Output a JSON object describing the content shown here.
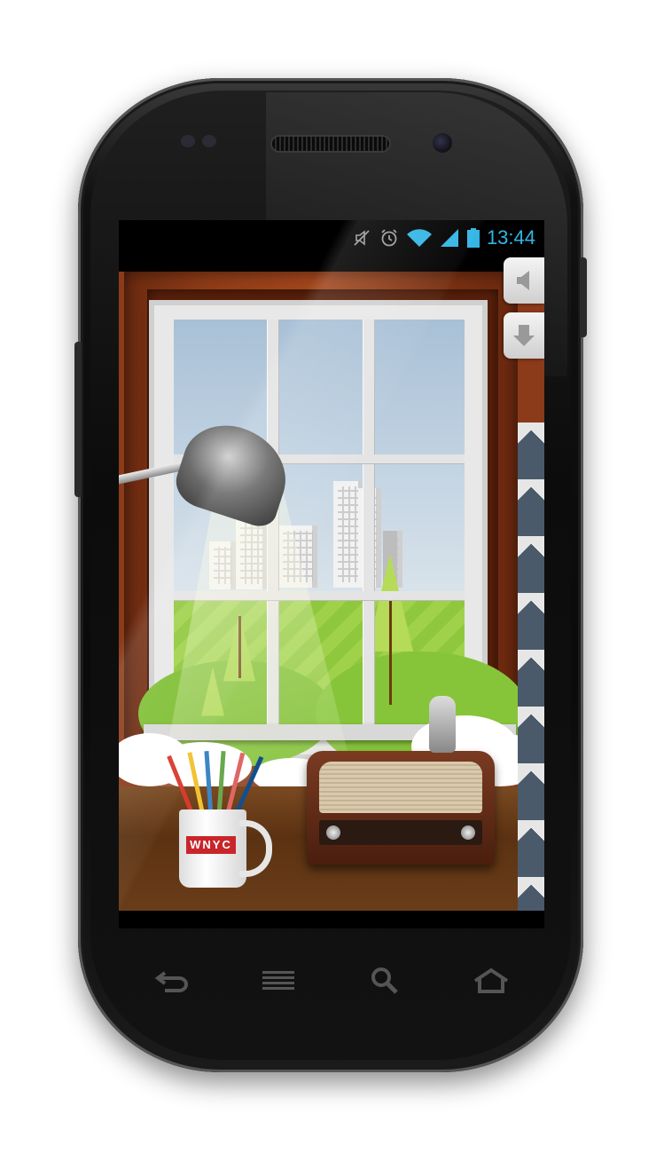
{
  "status_bar": {
    "time": "13:44",
    "icons": [
      "mute-icon",
      "alarm-icon",
      "wifi-icon",
      "signal-icon",
      "battery-icon"
    ],
    "accent_color": "#33b5e5"
  },
  "scene": {
    "mug_label": "WNYC",
    "mug_label_color": "#c8262b"
  },
  "side_controls": {
    "icons": [
      "volume-icon",
      "download-icon"
    ]
  },
  "nav_bar": {
    "icons": [
      "back-icon",
      "menu-icon",
      "search-icon",
      "home-icon"
    ]
  }
}
